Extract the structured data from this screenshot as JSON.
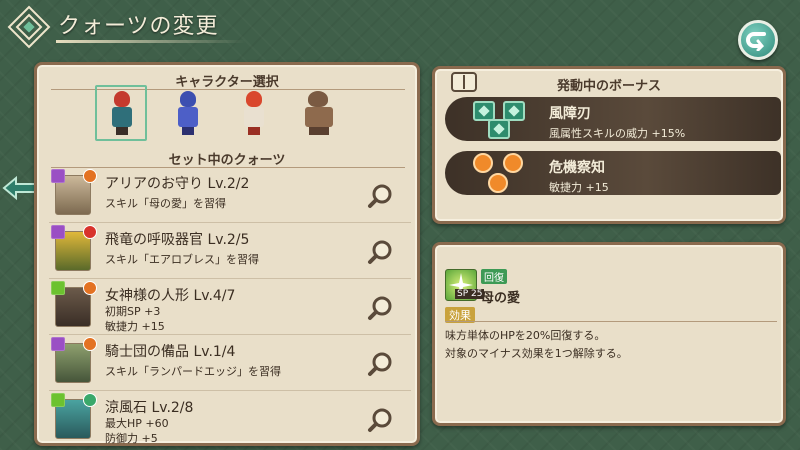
{
  "header": {
    "title": "クォーツの変更"
  },
  "character_select": {
    "title": "キャラクター選択"
  },
  "quartz": {
    "title": "セット中のクォーツ",
    "items": [
      {
        "name": "アリアのお守り Lv.2/2",
        "desc1": "スキル「母の愛」を習得",
        "desc2": ""
      },
      {
        "name": "飛竜の呼吸器官 Lv.2/5",
        "desc1": "スキル「エアロブレス」を習得",
        "desc2": ""
      },
      {
        "name": "女神様の人形 Lv.4/7",
        "desc1": "初期SP +3",
        "desc2": "敏捷力 +15"
      },
      {
        "name": "騎士団の備品 Lv.1/4",
        "desc1": "スキル「ランパードエッジ」を習得",
        "desc2": ""
      },
      {
        "name": "涼風石 Lv.2/8",
        "desc1": "最大HP +60",
        "desc2": "防御力 +5"
      }
    ]
  },
  "bonus": {
    "title": "発動中のボーナス",
    "items": [
      {
        "name": "風障刃",
        "desc": "風属性スキルの威力 +15%"
      },
      {
        "name": "危機察知",
        "desc": "敏捷力 +15"
      }
    ]
  },
  "skill": {
    "category": "回復",
    "sp": "SP 25",
    "name": "母の愛",
    "effect_label": "効果",
    "effect_lines": [
      "味方単体のHPを20%回復する。",
      "対象のマイナス効果を1つ解除する。"
    ]
  },
  "colors": {
    "accent": "#6fbf9a",
    "panel": "#e9dfc9",
    "background": "#3f5f49"
  }
}
